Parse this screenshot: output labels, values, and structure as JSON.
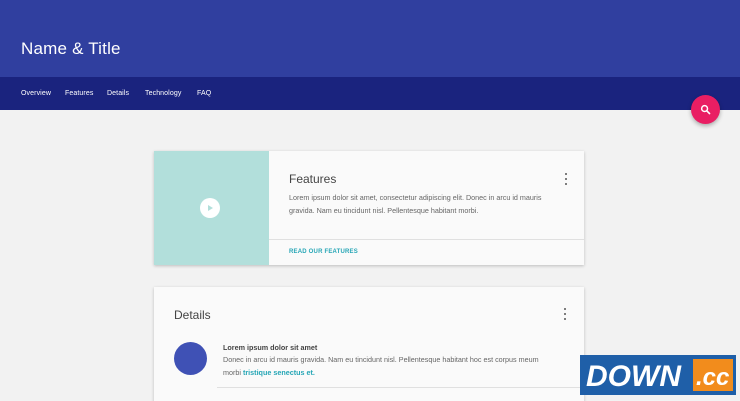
{
  "header": {
    "title": "Name & Title"
  },
  "nav": {
    "items": [
      {
        "label": "Overview"
      },
      {
        "label": "Features"
      },
      {
        "label": "Details"
      },
      {
        "label": "Technology"
      },
      {
        "label": "FAQ"
      }
    ]
  },
  "fab": {
    "icon": "search-icon",
    "color": "#e91e63"
  },
  "features_card": {
    "title": "Features",
    "text": "Lorem ipsum dolor sit amet, consectetur adipiscing elit. Donec in arcu id mauris gravida. Nam eu tincidunt nisl. Pellentesque habitant morbi.",
    "action": "READ OUR FEATURES",
    "media_color": "#b2dfdb",
    "media_icon": "play-icon"
  },
  "details_card": {
    "title": "Details",
    "item": {
      "heading": "Lorem ipsum dolor sit amet",
      "text": "Donec in arcu id mauris gravida. Nam eu tincidunt nisl. Pellentesque habitant hoc est corpus meum morbi",
      "link": "tristique senectus et."
    },
    "avatar_color": "#3f51b5"
  },
  "watermark": {
    "text": "DOWN.cc"
  },
  "colors": {
    "primary": "#303f9f",
    "primary_dark": "#1a237e",
    "accent": "#e91e63",
    "link": "#26a6b6"
  }
}
